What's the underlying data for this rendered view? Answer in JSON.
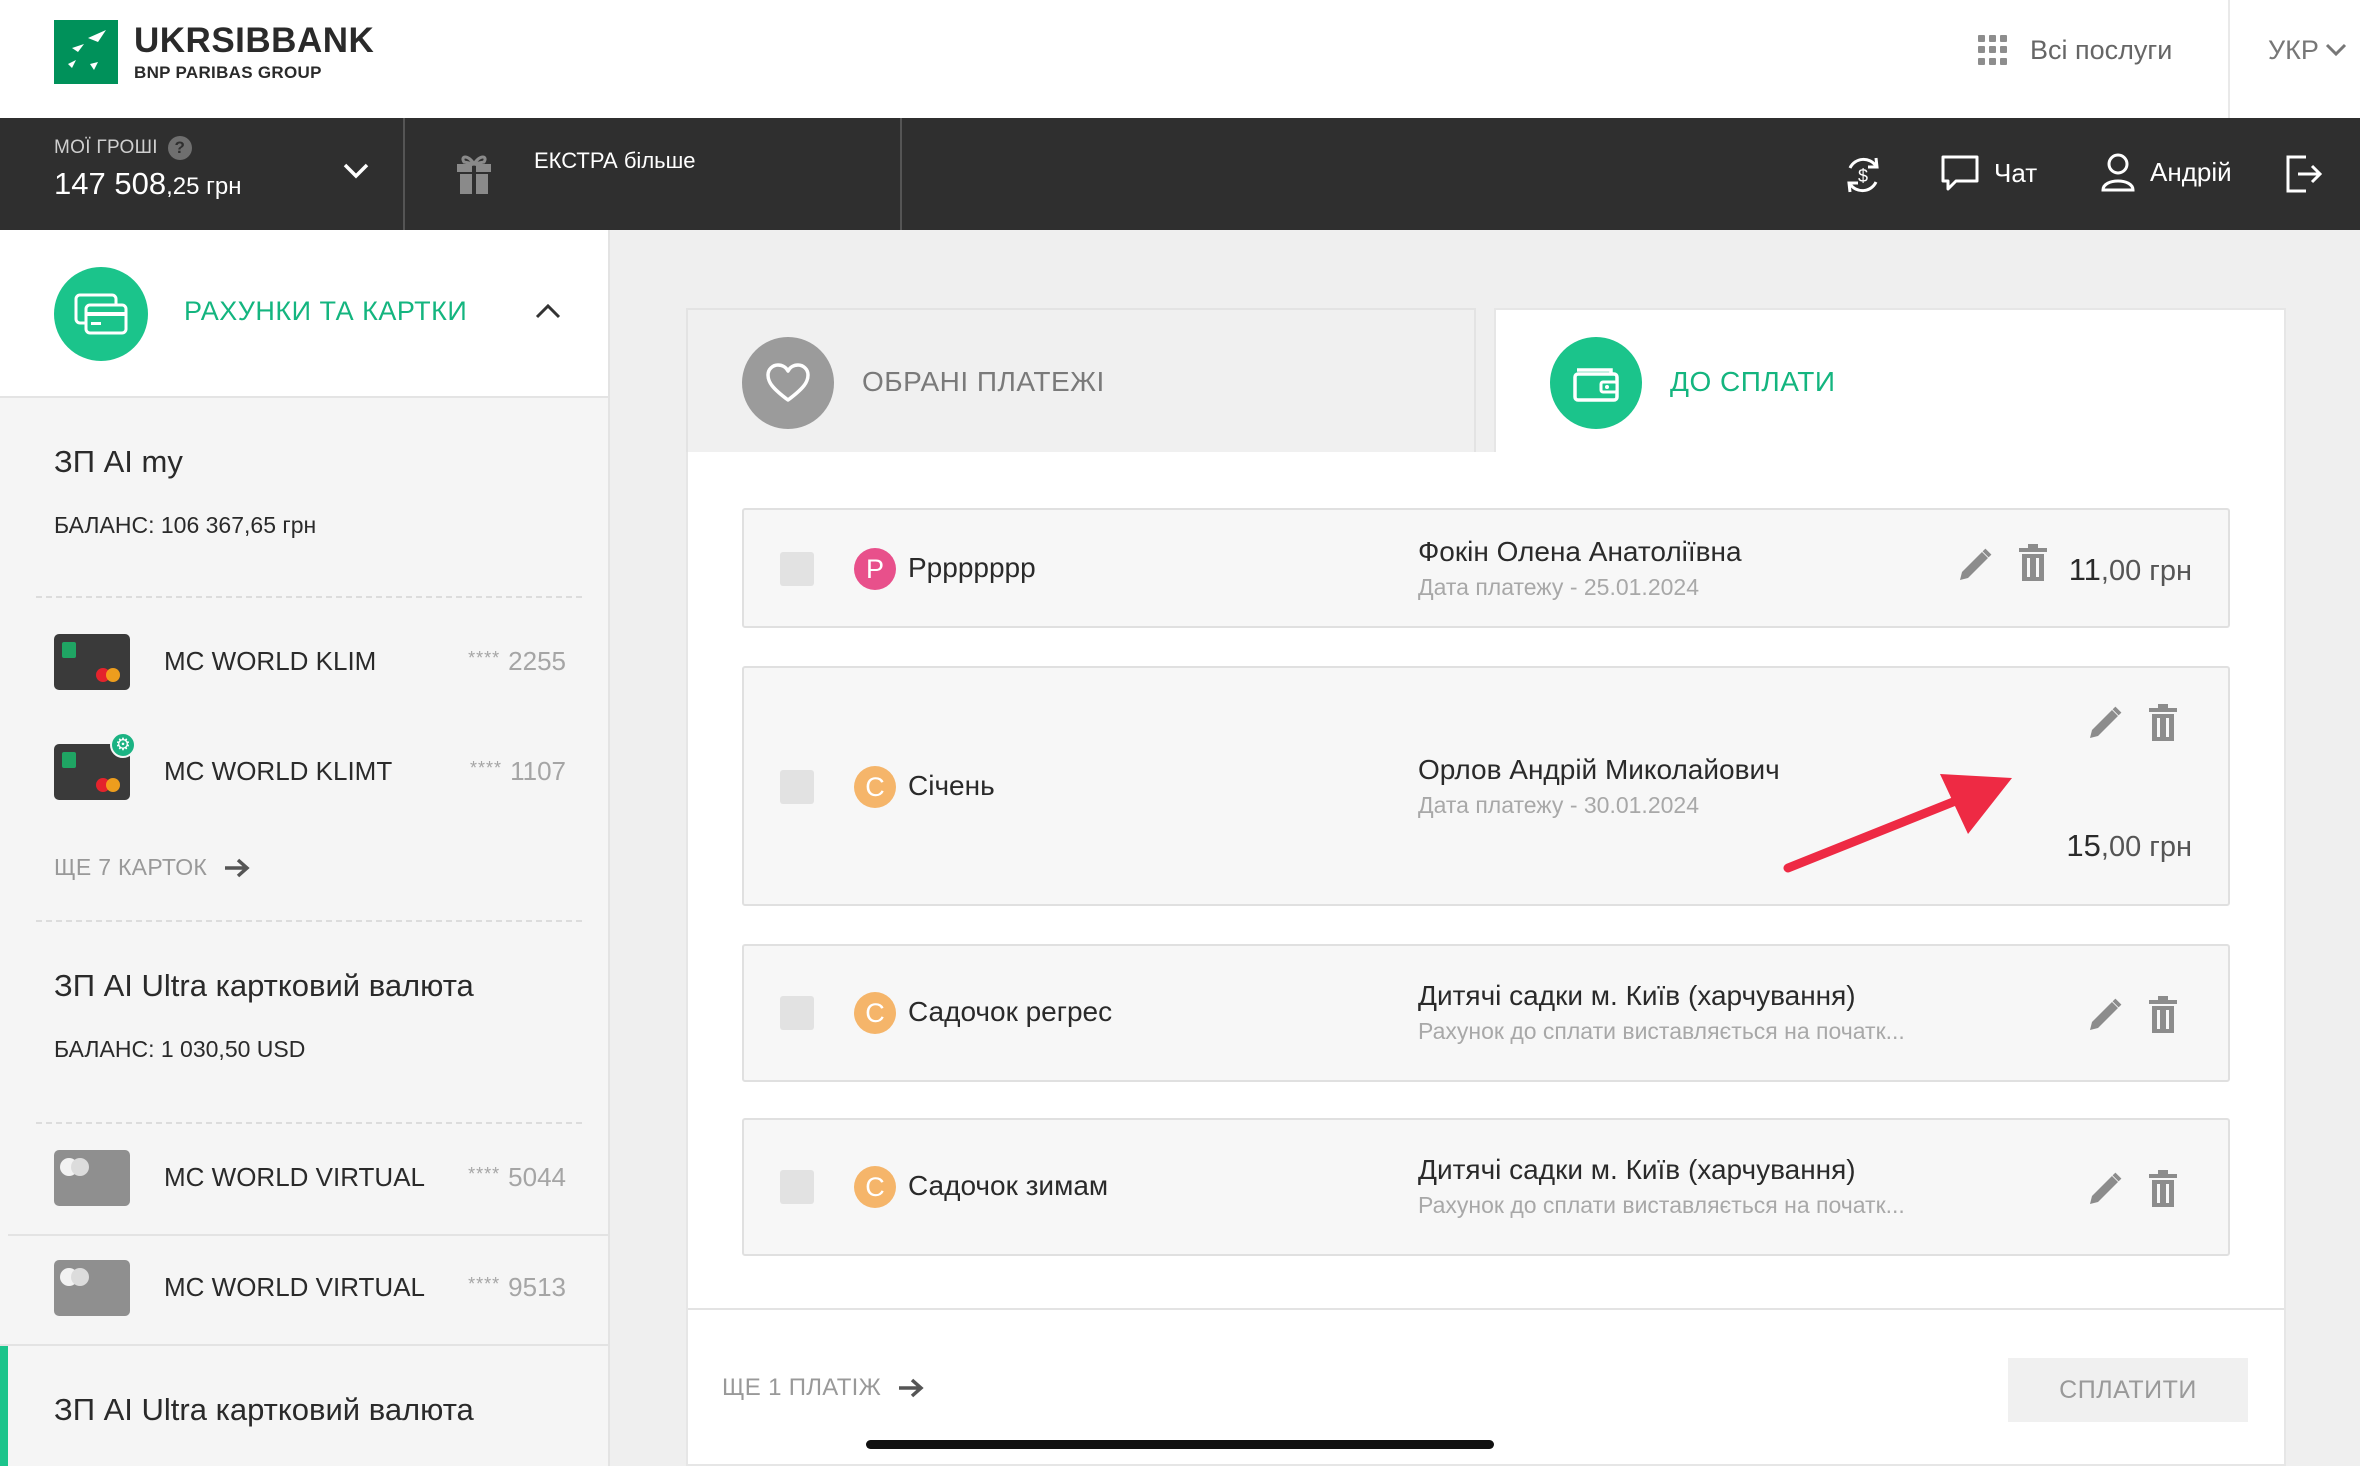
{
  "header": {
    "logo_title": "UKRSIBBANK",
    "logo_subtitle": "BNP PARIBAS GROUP",
    "all_services": "Всі послуги",
    "language": "УКР"
  },
  "topbar": {
    "money_label": "МОЇ ГРОШІ",
    "help_glyph": "?",
    "money_amount": "147 508",
    "money_fraction": ",25 грн",
    "extra_label": "ЕКСТРА більше",
    "chat_label": "Чат",
    "user_name": "Андрій"
  },
  "sidebar": {
    "title": "РАХУНКИ ТА КАРТКИ",
    "accounts": [
      {
        "name": "ЗП AI my",
        "balance": "БАЛАНС: 106 367,65 грн",
        "cards": [
          {
            "name": "MC WORLD KLIM",
            "stars": "****",
            "number": "2255"
          },
          {
            "name": "MC WORLD KLIMT",
            "stars": "****",
            "number": "1107"
          }
        ],
        "more_cards": "ЩЕ 7 КАРТОК"
      },
      {
        "name": "ЗП AI Ultra картковий валюта",
        "balance": "БАЛАНС: 1 030,50 USD",
        "cards": [
          {
            "name": "MC WORLD VIRTUAL",
            "stars": "****",
            "number": "5044"
          },
          {
            "name": "MC WORLD VIRTUAL",
            "stars": "****",
            "number": "9513"
          }
        ]
      },
      {
        "name": "ЗП AI Ultra картковий валюта"
      }
    ]
  },
  "tabs": {
    "favorites": "ОБРАНІ ПЛАТЕЖІ",
    "due": "ДО СПЛАТИ"
  },
  "payments": [
    {
      "letter": "P",
      "name": "Рррррррр",
      "recipient": "Фокін Олена Анатоліївна",
      "detail": "Дата платежу - 25.01.2024",
      "amount": "11",
      "fraction": ",00 грн"
    },
    {
      "letter": "С",
      "name": "Січень",
      "recipient": "Орлов Андрій Миколайович",
      "detail": "Дата платежу - 30.01.2024",
      "amount": "15",
      "fraction": ",00 грн"
    },
    {
      "letter": "С",
      "name": "Садочок регрес",
      "recipient": "Дитячі садки м. Київ (харчування)",
      "detail": "Рахунок до сплати виставляється на початк..."
    },
    {
      "letter": "С",
      "name": "Садочок зимам",
      "recipient": "Дитячі садки м. Київ (харчування)",
      "detail": "Рахунок до сплати виставляється на початк..."
    }
  ],
  "footer": {
    "more_payments": "ЩЕ 1 ПЛАТІЖ",
    "pay_button": "СПЛАТИТИ"
  },
  "colors": {
    "brand_green": "#1bc48b",
    "topbar_bg": "#2f2f2f",
    "annotation_arrow": "#ee2a44"
  },
  "icons": [
    "grid-icon",
    "chevron-down-icon",
    "gift-icon",
    "exchange-icon",
    "chat-icon",
    "user-icon",
    "logout-icon",
    "cards-icon",
    "chevron-up-icon",
    "arrow-right-icon",
    "heart-icon",
    "wallet-icon",
    "edit-icon",
    "trash-icon",
    "settings-icon"
  ]
}
